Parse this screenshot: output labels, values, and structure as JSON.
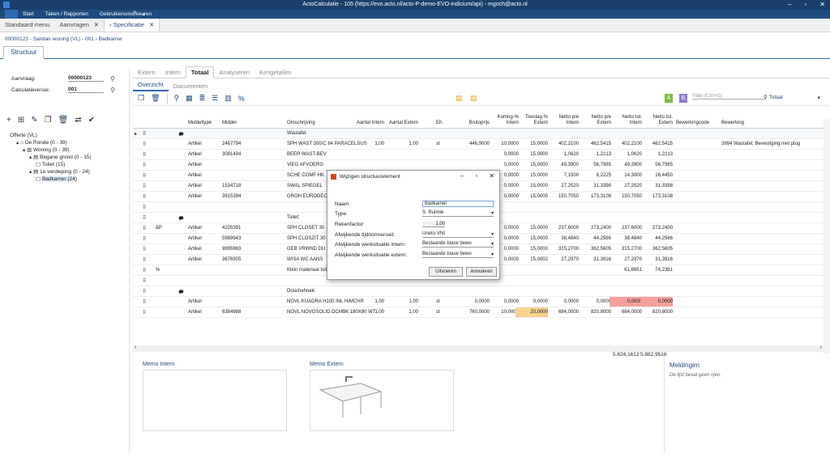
{
  "window": {
    "title": "ActoCalculatie - 105 (https://evo.acto.nl/acto-P-demo-EVO-indicium/api) - mgoch@acto.nl"
  },
  "menu": {
    "items": [
      "Start",
      "Taken / Rapporten",
      "Gebruikersvoorkeuren"
    ]
  },
  "tabs": [
    {
      "label": "Standaard menu"
    },
    {
      "label": "Aanvragen"
    },
    {
      "label": "› Specificatie"
    }
  ],
  "breadcrumb": "00000123 - Sanitair woning (VL) - 001 › Badkamer",
  "section_tab": "Structuur",
  "fields": {
    "aanvraag_label": "Aanvraag:",
    "aanvraag_value": "00000123",
    "calc_label": "Calculatieversie:",
    "calc_value": "001"
  },
  "tree": [
    {
      "label": "Offerte (VL)",
      "indent": 0,
      "icon": ""
    },
    {
      "label": "De Ronde (0 - 39)",
      "indent": 1,
      "icon": "▴ ⌂"
    },
    {
      "label": "Woning (0 - 39)",
      "indent": 2,
      "icon": "▴ ▥"
    },
    {
      "label": "Begane grond (0 - 15)",
      "indent": 3,
      "icon": "▴ ▤"
    },
    {
      "label": "Toilet (15)",
      "indent": 4,
      "icon": "▢"
    },
    {
      "label": "1e verdieping (0 - 24)",
      "indent": 3,
      "icon": "▴ ▤"
    },
    {
      "label": "Badkamer (24)",
      "indent": 4,
      "icon": "▢",
      "selected": true
    }
  ],
  "subtabs": [
    "Extern",
    "Intern",
    "Totaal",
    "Analyseren",
    "Kengetallen"
  ],
  "subtabs2": [
    "Overzicht",
    "Documenten"
  ],
  "filter_placeholder": "Filter (Ctrl+G)",
  "total_label": "Totaal",
  "badges": {
    "a": "A",
    "b": "B"
  },
  "columns": [
    "Middeltype",
    "Middel",
    "Omschrijving",
    "Aantal Intern",
    "Aantal Extern",
    "Eh.",
    "Brutoprijs",
    "Korting-% Intern",
    "Toeslag-% Extern",
    "Netto p/e Intern",
    "Netto p/e Extern",
    "Netto tot. Intern",
    "Netto tot. Extern",
    "Bewerkingcode",
    "Bewerking"
  ],
  "rows": [
    {
      "g": "",
      "type": "",
      "middel": "",
      "omschr": "Wastafel:",
      "ai": "",
      "ae": "",
      "eh": "",
      "bruto": "",
      "kort": "",
      "toesl": "",
      "npi": "",
      "npe": "",
      "nti": "",
      "nte": "",
      "bc": "",
      "bew": "",
      "hdr": true
    },
    {
      "g": "",
      "type": "Artikel",
      "middel": "2467794",
      "omschr": "SPH WAST 300/C 64 PARACELSUS",
      "ai": "1,00",
      "ae": "1,00",
      "eh": "st",
      "bruto": "446,9000",
      "kort": "10,0000",
      "toesl": "15,0000",
      "npi": "402,2100",
      "npe": "462,5415",
      "nti": "402,2100",
      "nte": "462,5415",
      "bc": "",
      "bew": "3994 Wastafel; Bevestiging met plug"
    },
    {
      "g": "",
      "type": "Artikel",
      "middel": "3081494",
      "omschr": "BEER WAST-BEV",
      "ai": "",
      "ae": "",
      "eh": "",
      "bruto": "",
      "kort": "0,0000",
      "toesl": "15,0000",
      "npi": "1,0620",
      "npe": "1,2213",
      "nti": "1,0620",
      "nte": "1,2213",
      "bc": "",
      "bew": ""
    },
    {
      "g": "",
      "type": "Artikel",
      "middel": "",
      "omschr": "VIEG AFVOERG",
      "ai": "",
      "ae": "",
      "eh": "",
      "bruto": "",
      "kort": "0,0000",
      "toesl": "15,0000",
      "npi": "49,3900",
      "npe": "56,7985",
      "nti": "49,3900",
      "nte": "56,7985",
      "bc": "",
      "bew": ""
    },
    {
      "g": "",
      "type": "Artikel",
      "middel": "",
      "omschr": "SCHE COMF HK",
      "ai": "",
      "ae": "",
      "eh": "",
      "bruto": "",
      "kort": "0,0000",
      "toesl": "15,0000",
      "npi": "7,1500",
      "npe": "8,2225",
      "nti": "14,3000",
      "nte": "16,4450",
      "bc": "",
      "bew": ""
    },
    {
      "g": "",
      "type": "Artikel",
      "middel": "1534718",
      "omschr": "SWAL SPIEGEL",
      "ai": "",
      "ae": "",
      "eh": "",
      "bruto": "",
      "kort": "0,0000",
      "toesl": "15,0000",
      "npi": "27,2520",
      "npe": "31,3398",
      "nti": "27,2520",
      "nte": "31,3398",
      "bc": "",
      "bew": ""
    },
    {
      "g": "",
      "type": "Artikel",
      "middel": "3915394",
      "omschr": "GROH EURODEC",
      "ai": "",
      "ae": "",
      "eh": "",
      "bruto": "",
      "kort": "0,0000",
      "toesl": "15,0000",
      "npi": "150,7050",
      "npe": "173,3108",
      "nti": "150,7050",
      "nte": "173,3108",
      "bc": "",
      "bew": ""
    },
    {
      "g": "",
      "type": "",
      "middel": "",
      "omschr": "",
      "ai": "",
      "ae": "",
      "eh": "",
      "bruto": "",
      "kort": "",
      "toesl": "",
      "npi": "",
      "npe": "",
      "nti": "",
      "nte": "",
      "bc": "",
      "bew": ""
    },
    {
      "g": "",
      "type": "",
      "middel": "",
      "omschr": "Toilet:",
      "ai": "",
      "ae": "",
      "eh": "",
      "bruto": "",
      "kort": "",
      "toesl": "",
      "npi": "",
      "npe": "",
      "nti": "",
      "nte": "",
      "bc": "",
      "bew": ""
    },
    {
      "g": "&P",
      "type": "Artikel",
      "middel": "4205391",
      "omschr": "SPH CLOSET 30",
      "ai": "",
      "ae": "",
      "eh": "",
      "bruto": "",
      "kort": "0,0000",
      "toesl": "15,0000",
      "npi": "237,6000",
      "npe": "273,2400",
      "nti": "237,6000",
      "nte": "273,2400",
      "bc": "",
      "bew": ""
    },
    {
      "g": "",
      "type": "Artikel",
      "middel": "5989943",
      "omschr": "SPH CLOSZIT 30",
      "ai": "",
      "ae": "",
      "eh": "",
      "bruto": "",
      "kort": "0,0000",
      "toesl": "15,0000",
      "npi": "38,4840",
      "npe": "44,2566",
      "nti": "38,4840",
      "nte": "44,2566",
      "bc": "",
      "bew": ""
    },
    {
      "g": "",
      "type": "Artikel",
      "middel": "9895963",
      "omschr": "GEB VRWND DU",
      "ai": "",
      "ae": "",
      "eh": "",
      "bruto": "",
      "kort": "0,0000",
      "toesl": "15,0000",
      "npi": "315,2700",
      "npe": "362,5605",
      "nti": "315,2700",
      "nte": "362,5605",
      "bc": "",
      "bew": ""
    },
    {
      "g": "",
      "type": "Artikel",
      "middel": "3676905",
      "omschr": "WISA WC AANS",
      "ai": "",
      "ae": "",
      "eh": "",
      "bruto": "",
      "kort": "0,0000",
      "toesl": "15,0002",
      "npi": "27,2970",
      "npe": "31,3916",
      "nti": "27,2970",
      "nte": "31,3916",
      "bc": "",
      "bew": ""
    },
    {
      "g": "%",
      "type": "",
      "middel": "",
      "omschr": "Klein materiaal toilet",
      "ai": "",
      "ae": "",
      "eh": "",
      "bruto": "",
      "kort": "",
      "toesl": "",
      "npi": "",
      "npe": "",
      "nti": "61,8651",
      "nte": "74,2381",
      "bc": "",
      "bew": ""
    },
    {
      "g": "",
      "type": "",
      "middel": "",
      "omschr": "",
      "ai": "",
      "ae": "",
      "eh": "",
      "bruto": "",
      "kort": "",
      "toesl": "",
      "npi": "",
      "npe": "",
      "nti": "",
      "nte": "",
      "bc": "",
      "bew": ""
    },
    {
      "g": "",
      "type": "",
      "middel": "",
      "omschr": "Douchehoek:",
      "ai": "",
      "ae": "",
      "eh": "",
      "bruto": "",
      "kort": "",
      "toesl": "",
      "npi": "",
      "npe": "",
      "nti": "",
      "nte": "",
      "bc": "",
      "bew": ""
    },
    {
      "g": "",
      "type": "Artikel",
      "middel": "",
      "omschr": "NOVL KUADRA H100 INL H/MCHR",
      "ai": "1,00",
      "ae": "1,00",
      "eh": "st",
      "bruto": "0,0000",
      "kort": "0,0000",
      "toesl": "0,0000",
      "npi": "0,0000",
      "npe": "0,0000",
      "nti": "0,0000",
      "nte": "0,0000",
      "bc": "",
      "bew": "",
      "red": true
    },
    {
      "g": "",
      "type": "Artikel",
      "middel": "6384988",
      "omschr": "NOVL NOVOSOLID DCHBK 180X90 WT",
      "ai": "1,00",
      "ae": "1,00",
      "eh": "st",
      "bruto": "760,0000",
      "kort": "10,0000",
      "toesl": "20,0000",
      "npi": "684,0000",
      "npe": "820,8000",
      "nti": "684,0000",
      "nte": "820,8000",
      "bc": "",
      "bew": "",
      "yel": true
    }
  ],
  "totals": {
    "intern": "5.624,1612",
    "extern": "5.882,9516"
  },
  "memo": {
    "intern": "Memo Intern",
    "extern": "Memo Extern"
  },
  "meldingen": {
    "title": "Meldingen",
    "text": "De lijst bevat geen rijen."
  },
  "dialog": {
    "title": "Wijzigen structuurelement",
    "naam_label": "Naam:",
    "naam_value": "Badkamer",
    "type_label": "Type:",
    "type_value": "S. Ruimte",
    "rek_label": "Rekenfactor:",
    "rek_value": "1,00",
    "tijd_label": "Afwijkende tijdnormenset:",
    "tijd_value": "Uneto-VNI",
    "wi_label": "Afwijkende werksituatie intern:",
    "wi_value": "Bestaande bouw bewo",
    "we_label": "Afwijkende werksituatie extern:",
    "we_value": "Bestaande bouw bewo",
    "ok": "Uitvoeren",
    "cancel": "Annuleren"
  }
}
